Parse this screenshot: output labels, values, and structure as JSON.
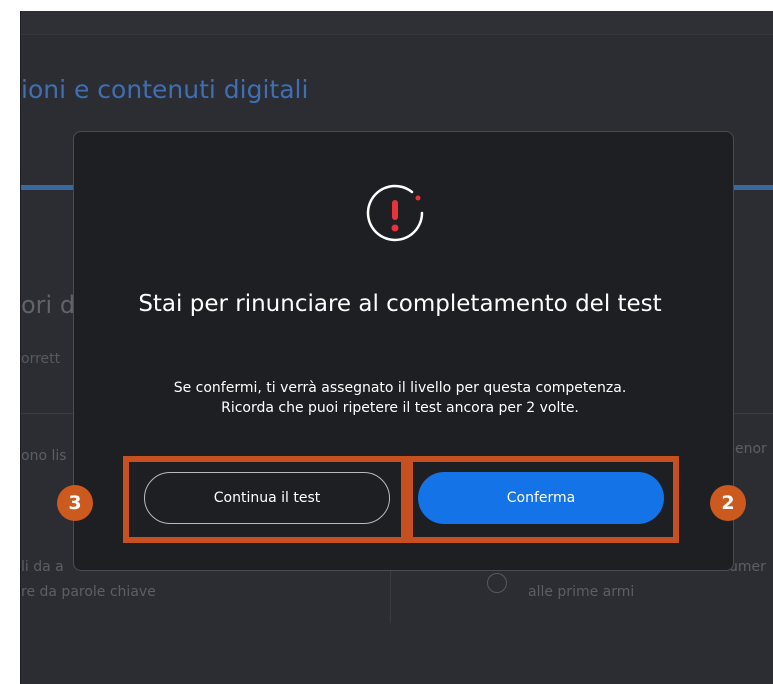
{
  "background": {
    "page_title": "ioni e contenuti digitali",
    "section_title": "ori d",
    "subtitle": "orrett",
    "left_row_text": "ono lis",
    "right_row_text": "enor",
    "left_bottom_line1": "li da a",
    "left_bottom_line2": "re da parole chiave",
    "right_bottom_edge": "umer",
    "right_bottom_option": "alle prime armi"
  },
  "modal": {
    "icon": "alert-exclamation-icon",
    "title": "Stai per rinunciare al completamento del test",
    "message": "Se confermi, ti verrà assegnato il livello per questa competenza. Ricorda che puoi ripetere il test ancora per 2 volte.",
    "secondary_button": "Continua il test",
    "primary_button": "Conferma"
  },
  "annotations": {
    "left_badge": "3",
    "right_badge": "2",
    "color": "#c75020"
  },
  "colors": {
    "accent": "#1473e6",
    "alert": "#e8333a",
    "modal_bg": "#1e1f22"
  }
}
